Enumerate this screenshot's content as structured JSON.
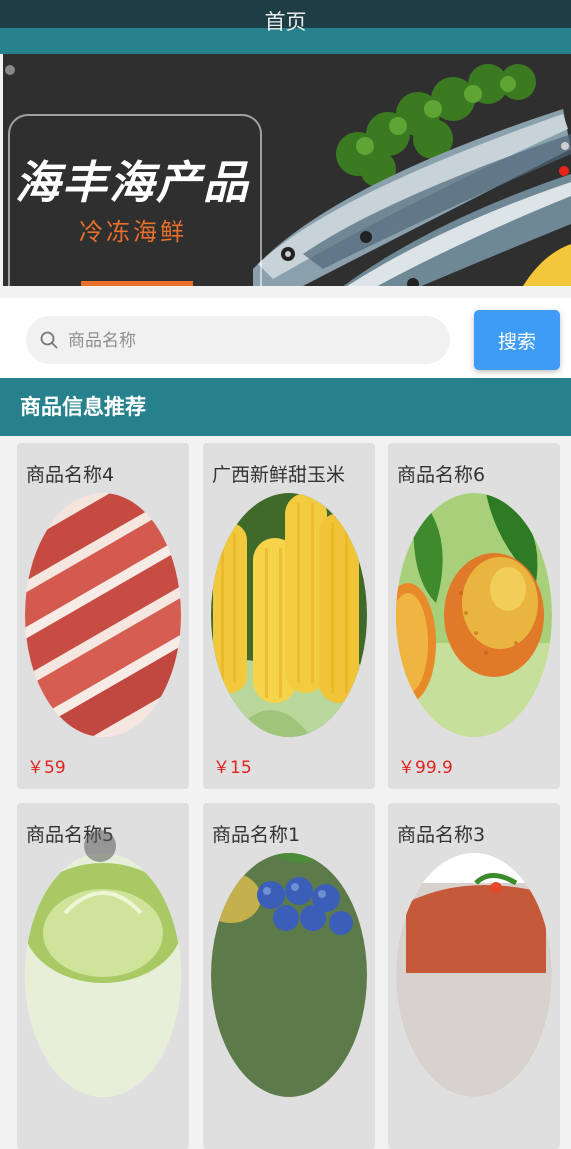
{
  "header": {
    "title": "首页"
  },
  "banner": {
    "title": "海丰海产品",
    "subtitle": "冷冻海鲜",
    "active_slide": 2,
    "slide_count": 2
  },
  "search": {
    "placeholder": "商品名称",
    "value": "",
    "button_label": "搜索"
  },
  "section": {
    "title": "商品信息推荐"
  },
  "products": [
    {
      "name": "商品名称4",
      "price": "￥59",
      "image": "pork-belly"
    },
    {
      "name": "广西新鲜甜玉米",
      "price": "￥15",
      "image": "corn"
    },
    {
      "name": "商品名称6",
      "price": "￥99.9",
      "image": "mango"
    },
    {
      "name": "商品名称5",
      "price": "",
      "image": "cabbage"
    },
    {
      "name": "商品名称1",
      "price": "",
      "image": "blueberries"
    },
    {
      "name": "商品名称3",
      "price": "",
      "image": "dish"
    }
  ],
  "colors": {
    "primary": "#26818d",
    "header_dark": "#1e3d44",
    "button": "#3e9bf6",
    "price": "#e02420",
    "banner_accent": "#e8702a"
  }
}
